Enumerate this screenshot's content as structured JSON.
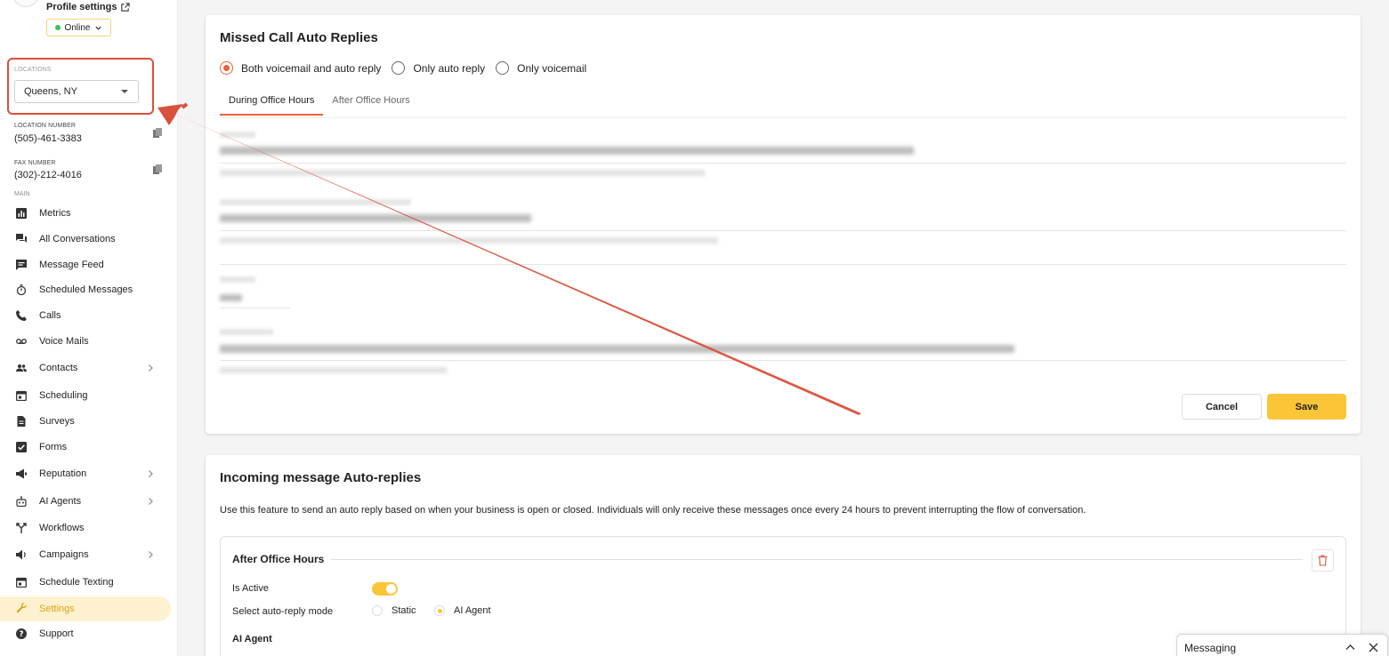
{
  "sidebar": {
    "profile_settings": "Profile settings",
    "status": "Online",
    "locations_label": "LOCATIONS",
    "location_value": "Queens, NY",
    "location_number_label": "LOCATION NUMBER",
    "location_number": "(505)-461-3383",
    "fax_number_label": "FAX NUMBER",
    "fax_number": "(302)-212-4016",
    "main_label": "MAIN",
    "items": [
      {
        "label": "Metrics",
        "icon": "chart-icon"
      },
      {
        "label": "All Conversations",
        "icon": "chats-icon"
      },
      {
        "label": "Message Feed",
        "icon": "message-icon"
      },
      {
        "label": "Scheduled Messages",
        "icon": "timer-icon"
      },
      {
        "label": "Calls",
        "icon": "phone-icon"
      },
      {
        "label": "Voice Mails",
        "icon": "voicemail-icon"
      },
      {
        "label": "Contacts",
        "icon": "people-icon"
      },
      {
        "label": "Scheduling",
        "icon": "calendar-icon"
      },
      {
        "label": "Surveys",
        "icon": "document-icon"
      },
      {
        "label": "Forms",
        "icon": "checkbox-icon"
      },
      {
        "label": "Reputation",
        "icon": "megaphone-icon"
      },
      {
        "label": "AI Agents",
        "icon": "robot-icon"
      },
      {
        "label": "Workflows",
        "icon": "fork-icon"
      },
      {
        "label": "Campaigns",
        "icon": "speaker-icon"
      },
      {
        "label": "Schedule Texting",
        "icon": "calendar-icon"
      },
      {
        "label": "Settings",
        "icon": "wrench-icon"
      },
      {
        "label": "Support",
        "icon": "help-icon"
      }
    ]
  },
  "missed_call": {
    "title": "Missed Call Auto Replies",
    "options": [
      "Both voicemail and auto reply",
      "Only auto reply",
      "Only voicemail"
    ],
    "selected_option": "Both voicemail and auto reply",
    "tabs": [
      "During Office Hours",
      "After Office Hours"
    ],
    "active_tab": "During Office Hours",
    "cancel_label": "Cancel",
    "save_label": "Save"
  },
  "incoming": {
    "title": "Incoming message Auto-replies",
    "description": "Use this feature to send an auto reply based on when your business is open or closed. Individuals will only receive these messages once every 24 hours to prevent interrupting the flow of conversation.",
    "section_title": "After Office Hours",
    "is_active_label": "Is Active",
    "is_active": true,
    "mode_label": "Select auto-reply mode",
    "mode_options": [
      "Static",
      "AI Agent"
    ],
    "mode_selected": "AI Agent",
    "ai_agent_heading": "AI Agent"
  },
  "messaging_widget": {
    "title": "Messaging"
  },
  "colors": {
    "accent": "#fac537",
    "radio_accent": "#e8643c",
    "annotation": "#d9503b"
  }
}
